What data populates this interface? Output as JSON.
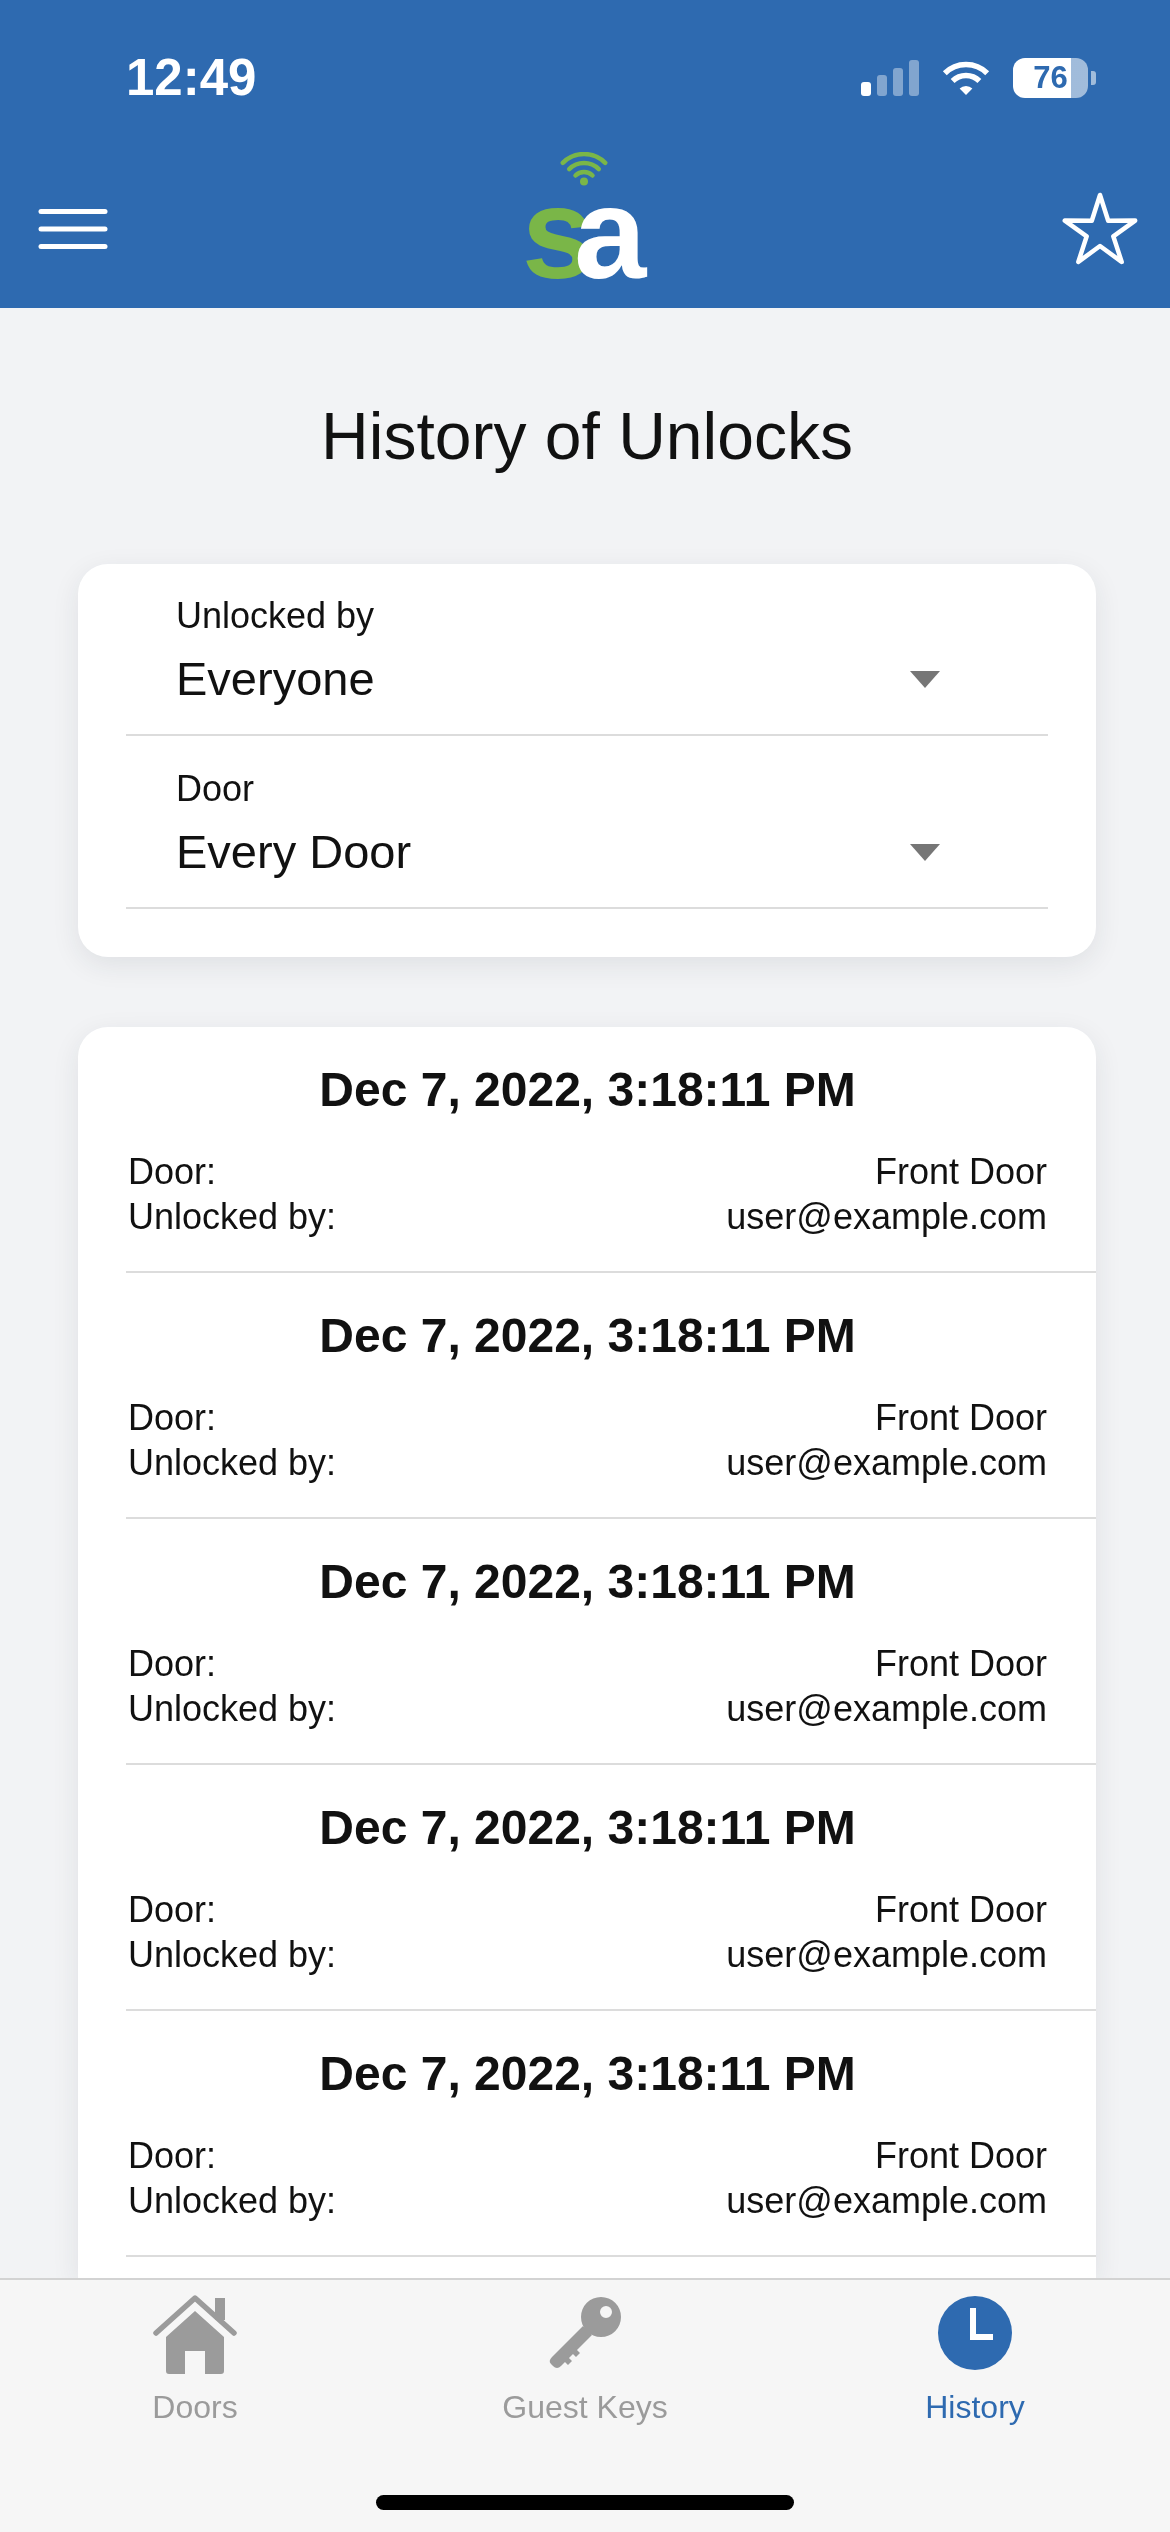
{
  "status_bar": {
    "time": "12:49",
    "battery": "76"
  },
  "app_bar": {
    "logo": [
      "s",
      "a"
    ]
  },
  "title": "History of Unlocks",
  "filters": [
    {
      "label": "Unlocked by",
      "value": "Everyone"
    },
    {
      "label": "Door",
      "value": "Every Door"
    }
  ],
  "unlocks": [
    {
      "timestamp": "Dec 7, 2022, 3:18:11 PM",
      "fields": [
        {
          "label": "Door:",
          "value": "Front Door"
        },
        {
          "label": "Unlocked by:",
          "value": "user@example.com"
        }
      ]
    },
    {
      "timestamp": "Dec 7, 2022, 3:18:11 PM",
      "fields": [
        {
          "label": "Door:",
          "value": "Front Door"
        },
        {
          "label": "Unlocked by:",
          "value": "user@example.com"
        }
      ]
    },
    {
      "timestamp": "Dec 7, 2022, 3:18:11 PM",
      "fields": [
        {
          "label": "Door:",
          "value": "Front Door"
        },
        {
          "label": "Unlocked by:",
          "value": "user@example.com"
        }
      ]
    },
    {
      "timestamp": "Dec 7, 2022, 3:18:11 PM",
      "fields": [
        {
          "label": "Door:",
          "value": "Front Door"
        },
        {
          "label": "Unlocked by:",
          "value": "user@example.com"
        }
      ]
    },
    {
      "timestamp": "Dec 7, 2022, 3:18:11 PM",
      "fields": [
        {
          "label": "Door:",
          "value": "Front Door"
        },
        {
          "label": "Unlocked by:",
          "value": "user@example.com"
        }
      ]
    }
  ],
  "tab_bar": [
    {
      "label": "Doors",
      "selected": false
    },
    {
      "label": "Guest Keys",
      "selected": false
    },
    {
      "label": "History",
      "selected": true
    }
  ]
}
